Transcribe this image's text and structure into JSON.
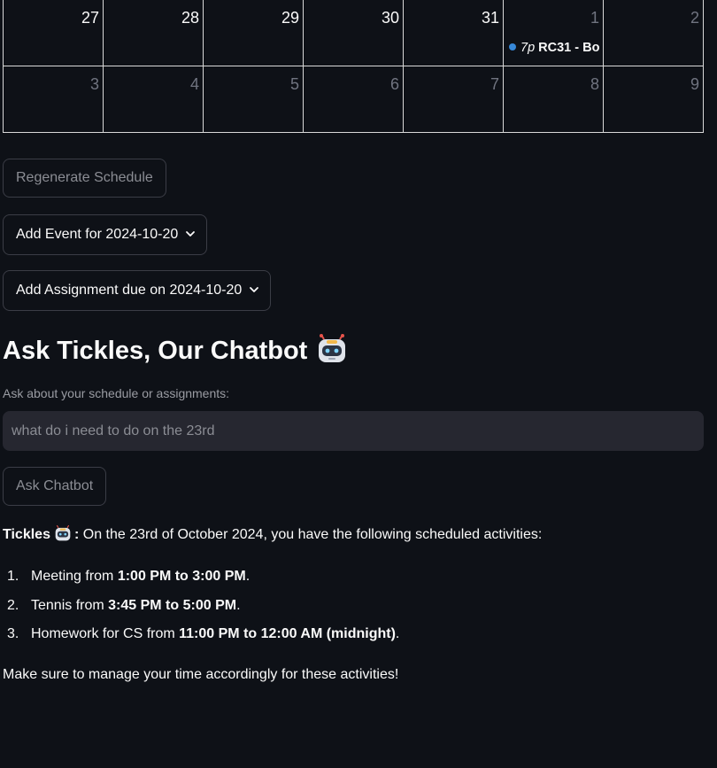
{
  "calendar": {
    "weeks": [
      [
        {
          "day": "27",
          "current": true
        },
        {
          "day": "28",
          "current": true
        },
        {
          "day": "29",
          "current": true
        },
        {
          "day": "30",
          "current": true
        },
        {
          "day": "31",
          "current": true
        },
        {
          "day": "1",
          "current": false,
          "event": {
            "time": "7p",
            "title": "RC31 - Bo"
          }
        },
        {
          "day": "2",
          "current": false
        }
      ],
      [
        {
          "day": "3",
          "current": false
        },
        {
          "day": "4",
          "current": false
        },
        {
          "day": "5",
          "current": false
        },
        {
          "day": "6",
          "current": false
        },
        {
          "day": "7",
          "current": false
        },
        {
          "day": "8",
          "current": false
        },
        {
          "day": "9",
          "current": false
        }
      ]
    ],
    "event_dot_color": "#3788d8"
  },
  "buttons": {
    "regenerate": "Regenerate Schedule",
    "ask": "Ask Chatbot"
  },
  "expanders": {
    "add_event": "Add Event for 2024-10-20",
    "add_assignment": "Add Assignment due on 2024-10-20"
  },
  "chat": {
    "heading": "Ask Tickles, Our Chatbot",
    "input_label": "Ask about your schedule or assignments:",
    "input_value": "what do i need to do on the 23rd",
    "response": {
      "speaker": "Tickles",
      "intro": "On the 23rd of October 2024, you have the following scheduled activities:",
      "items": [
        {
          "num": "1.",
          "text": "Meeting from ",
          "bold": "1:00 PM to 3:00 PM",
          "end": "."
        },
        {
          "num": "2.",
          "text": "Tennis from ",
          "bold": "3:45 PM to 5:00 PM",
          "end": "."
        },
        {
          "num": "3.",
          "text": "Homework for CS from ",
          "bold": "11:00 PM to 12:00 AM (midnight)",
          "end": "."
        }
      ],
      "closing": "Make sure to manage your time accordingly for these activities!"
    }
  }
}
